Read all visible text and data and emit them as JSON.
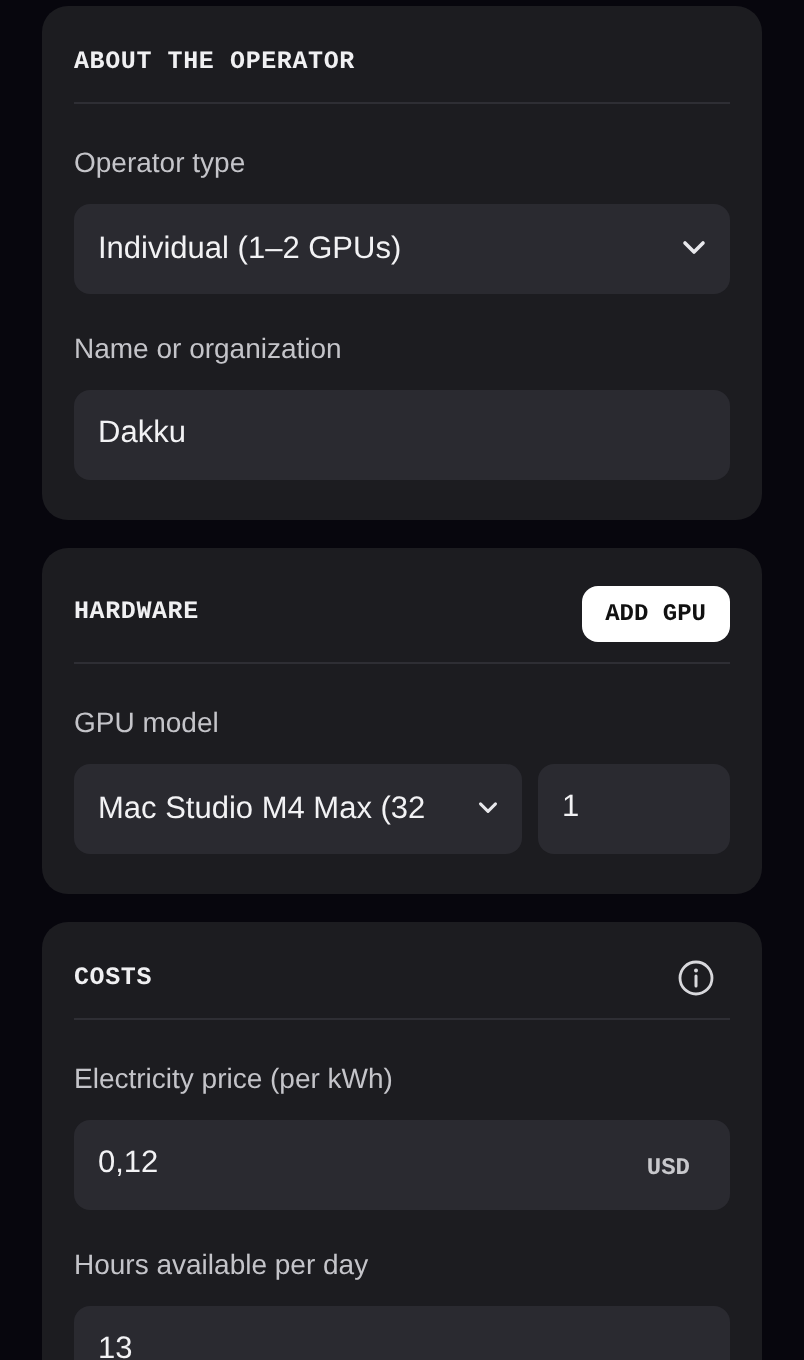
{
  "sections": [
    {
      "title": "ABOUT THE OPERATOR",
      "fields": [
        {
          "kind": "select",
          "label": "Operator type",
          "value": "Individual (1–2 GPUs)"
        },
        {
          "kind": "text",
          "label": "Name or organization",
          "value": "Dakku"
        }
      ]
    },
    {
      "title": "HARDWARE",
      "action": "ADD GPU",
      "fields": [
        {
          "kind": "select-count",
          "label": "GPU model",
          "value": "Mac Studio M4 Max (32",
          "count": "1"
        }
      ]
    },
    {
      "title": "COSTS",
      "info": true,
      "fields": [
        {
          "kind": "text",
          "label": "Electricity price (per kWh)",
          "value": "0,12",
          "unit": "USD"
        },
        {
          "kind": "text",
          "label": "Hours available per day",
          "value": "13"
        }
      ]
    }
  ]
}
